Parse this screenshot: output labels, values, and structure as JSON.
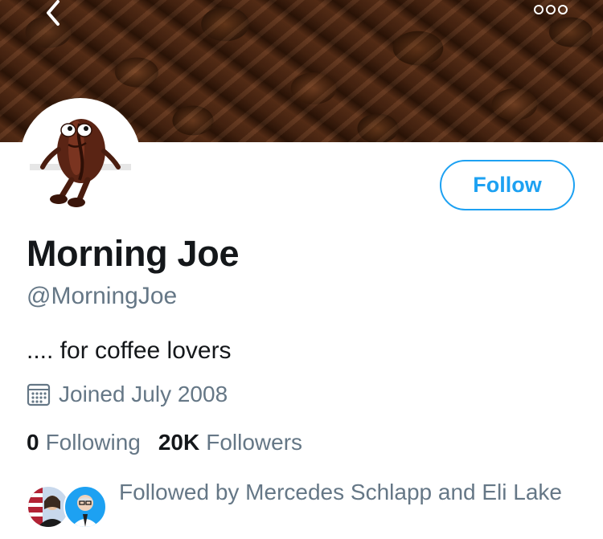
{
  "header": {
    "back_icon": "chevron-left-icon",
    "more_icon": "more-options-icon"
  },
  "profile": {
    "display_name": "Morning Joe",
    "handle": "@MorningJoe",
    "bio": ".... for coffee lovers",
    "joined": "Joined July 2008",
    "follow_label": "Follow",
    "following_count": "0",
    "following_label": "Following",
    "followers_count": "20K",
    "followers_label": "Followers",
    "followed_by": "Followed by Mercedes Schlapp and Eli Lake"
  },
  "colors": {
    "accent": "#1da1f2",
    "secondary_text": "#657786",
    "primary_text": "#14171a"
  }
}
